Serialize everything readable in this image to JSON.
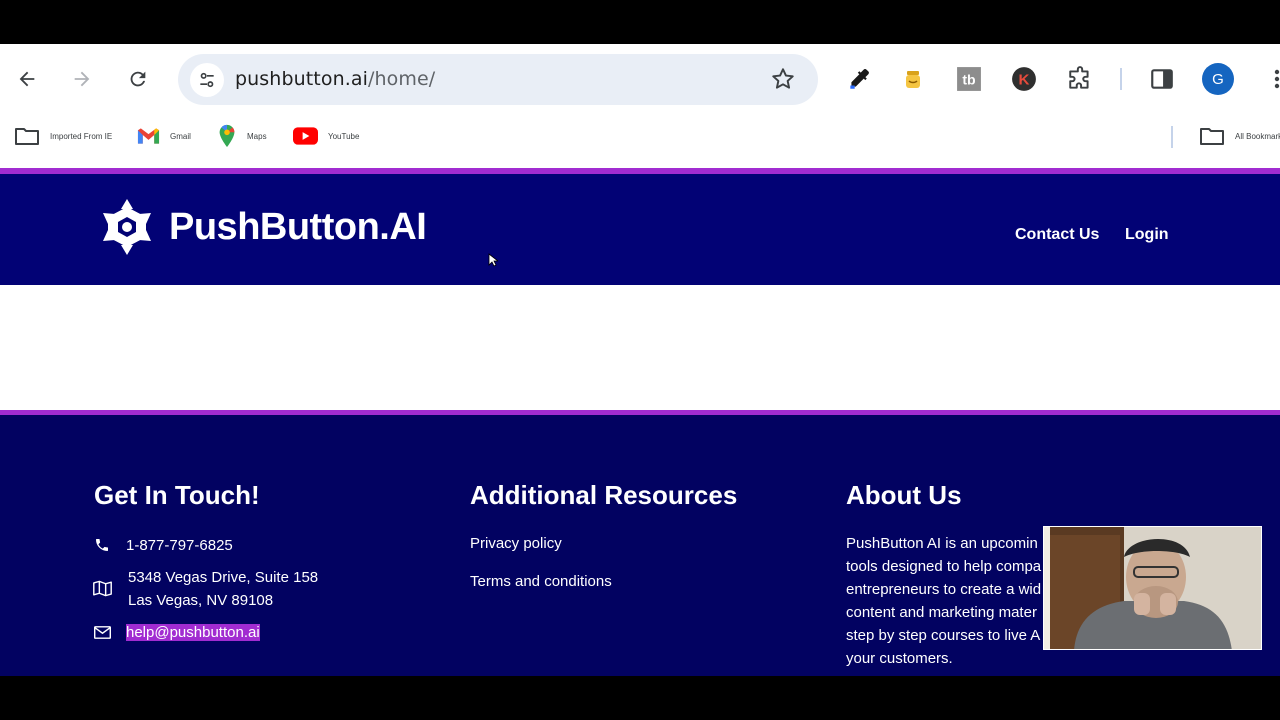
{
  "browser": {
    "url_host": "pushbutton.ai",
    "url_path": "/home/",
    "profile_initial": "G"
  },
  "bookmarks": [
    {
      "label": "Imported From IE",
      "icon": "folder-icon"
    },
    {
      "label": "Gmail",
      "icon": "gmail-icon"
    },
    {
      "label": "Maps",
      "icon": "maps-icon"
    },
    {
      "label": "YouTube",
      "icon": "youtube-icon"
    }
  ],
  "all_bookmarks_label": "All Bookmarks",
  "header": {
    "logo_text": "PushButton.AI",
    "nav": [
      "Contact Us",
      "Login"
    ]
  },
  "footer": {
    "contact": {
      "heading": "Get In Touch!",
      "phone": "1-877-797-6825",
      "address_line1": "5348 Vegas Drive, Suite 158",
      "address_line2": "Las Vegas, NV 89108",
      "email": "help@pushbutton.ai"
    },
    "resources": {
      "heading": "Additional Resources",
      "links": [
        "Privacy policy",
        "Terms and conditions"
      ]
    },
    "about": {
      "heading": "About Us",
      "lines": [
        "PushButton AI is an upcomin",
        "tools designed to help compa",
        "entrepreneurs to create a wid",
        "content and marketing mater",
        "step by step courses to live A",
        "your customers."
      ]
    }
  },
  "colors": {
    "header_bg": "#020275",
    "footer_bg": "#020261",
    "accent": "#a12cd1"
  }
}
